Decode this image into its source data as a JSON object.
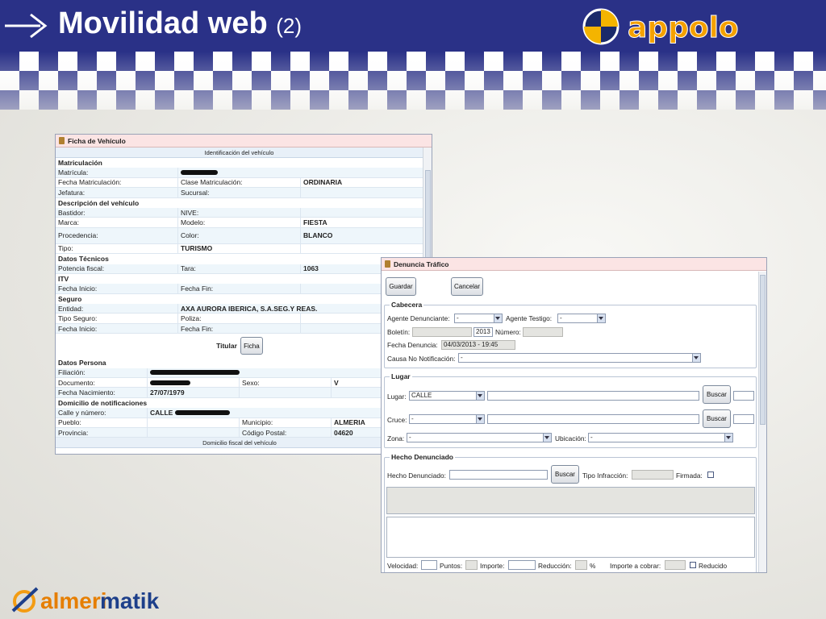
{
  "slide": {
    "title": "Movilidad web",
    "title_suffix": "(2)",
    "brand": "appolo",
    "footer_brand_a": "almeri",
    "footer_brand_b": "matik"
  },
  "vehiculo": {
    "window_title": "Ficha de Vehículo",
    "section_title": "Identificación del vehículo",
    "matriculacion": "Matriculación",
    "matricula_label": "Matrícula:",
    "fecha_matric_label": "Fecha Matriculación:",
    "clase_matric_label": "Clase Matriculación:",
    "clase_matric_value": "ORDINARIA",
    "jefatura_label": "Jefatura:",
    "sucursal_label": "Sucursal:",
    "descripcion": "Descripción del vehículo",
    "bastidor_label": "Bastidor:",
    "nive_label": "NIVE:",
    "marca_label": "Marca:",
    "modelo_label": "Modelo:",
    "modelo_value": "FIESTA",
    "procedencia_label": "Procedencia:",
    "color_label": "Color:",
    "color_value": "BLANCO",
    "tipo_label": "Tipo:",
    "tipo_value": "TURISMO",
    "datos_tecnicos": "Datos Técnicos",
    "potencia_label": "Potencia fiscal:",
    "tara_label": "Tara:",
    "tara_value": "1063",
    "itv": "ITV",
    "fecha_inicio_label": "Fecha Inicio:",
    "fecha_fin_label": "Fecha Fin:",
    "seguro": "Seguro",
    "entidad_label": "Entidad:",
    "entidad_value": "AXA AURORA IBERICA, S.A.SEG.Y REAS.",
    "tipo_seguro_label": "Tipo Seguro:",
    "poliza_label": "Poliza:",
    "fecha_inicio2_label": "Fecha Inicio:",
    "fecha_fin2_label": "Fecha Fin:",
    "titular_label": "Titular",
    "ficha_button": "Ficha",
    "datos_persona": "Datos Persona",
    "filiacion_label": "Filiación:",
    "documento_label": "Documento:",
    "sexo_label": "Sexo:",
    "sexo_value": "V",
    "fecha_nac_label": "Fecha Nacimiento:",
    "fecha_nac_value": "27/07/1979",
    "domicilio_notif": "Domicilio de notificaciones",
    "calle_label": "Calle y número:",
    "calle_value": "CALLE",
    "pueblo_label": "Pueblo:",
    "municipio_label": "Municipio:",
    "municipio_value": "ALMERIA",
    "provincia_label": "Provincia:",
    "cp_label": "Código Postal:",
    "cp_value": "04620",
    "domicilio_fiscal": "Domicilio fiscal del vehículo"
  },
  "denuncia": {
    "window_title": "Denuncia Tráfico",
    "guardar": "Guardar",
    "cancelar": "Cancelar",
    "cabecera": "Cabecera",
    "agente_den_label": "Agente Denunciante:",
    "agente_den_value": "-",
    "agente_test_label": "Agente Testigo:",
    "agente_test_value": "-",
    "boletin_label": "Boletín:",
    "boletin_year": "2013",
    "numero_label": "Número:",
    "fecha_den_label": "Fecha Denuncia:",
    "fecha_den_value": "04/03/2013 - 19:45",
    "causa_label": "Causa No Notificación:",
    "causa_value": "-",
    "lugar_group": "Lugar",
    "lugar_label": "Lugar:",
    "lugar_value": "CALLE",
    "buscar": "Buscar",
    "cruce_label": "Cruce:",
    "cruce_value": "-",
    "zona_label": "Zona:",
    "zona_value": "-",
    "ubicacion_label": "Ubicación:",
    "ubicacion_value": "-",
    "hecho_group": "Hecho Denunciado",
    "hecho_label": "Hecho Denunciado:",
    "tipo_infr_label": "Tipo Infracción:",
    "firmada_label": "Firmada:",
    "velocidad_label": "Velocidad:",
    "puntos_label": "Puntos:",
    "importe_label": "Importe:",
    "reduccion_label": "Reducción:",
    "pct": "%",
    "importe_cobrar_label": "Importe a cobrar:",
    "reducido_label": "Reducido"
  }
}
